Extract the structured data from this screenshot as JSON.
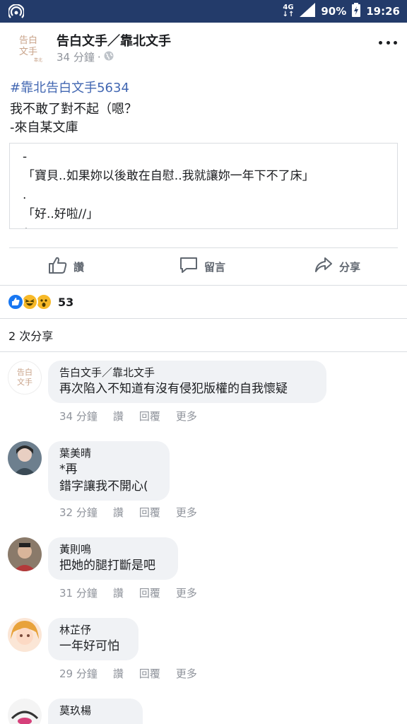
{
  "status_bar": {
    "network": "4G",
    "battery": "90%",
    "time": "19:26"
  },
  "post": {
    "page_name": "告白文手／靠北文手",
    "time": "34 分鐘",
    "meta_separator": "·",
    "avatar_text_top": "告白",
    "avatar_text_bottom": "文手",
    "avatar_text_small": "靠北",
    "hashtag": "#靠北告白文手5634",
    "text_line1": "我不敢了對不起（嗯？",
    "text_line2": "-來自某文庫",
    "quote_lines": [
      "-",
      "「寶貝..如果妳以後敢在自慰..我就讓妳一年下不了床」",
      ".",
      "「好..好啦//」",
      "/"
    ]
  },
  "actions": {
    "like": "讚",
    "comment": "留言",
    "share": "分享"
  },
  "reactions": {
    "count": "53"
  },
  "shares": {
    "text": "2 次分享"
  },
  "comment_actions": {
    "like": "讚",
    "reply": "回覆",
    "more": "更多"
  },
  "comments": [
    {
      "name": "告白文手／靠北文手",
      "lines": [
        "再次陷入不知道有沒有侵犯版權的自我懷疑"
      ],
      "time": "34 分鐘"
    },
    {
      "name": "葉美晴",
      "lines": [
        "*再",
        "錯字讓我不開心("
      ],
      "time": "32 分鐘"
    },
    {
      "name": "黃則鳴",
      "lines": [
        "把她的腿打斷是吧"
      ],
      "time": "31 分鐘"
    },
    {
      "name": "林芷伃",
      "lines": [
        "一年好可怕"
      ],
      "time": "29 分鐘"
    },
    {
      "name": "莫玖楊",
      "lines": [],
      "time": ""
    }
  ],
  "colors": {
    "status_bar": "#233b6a",
    "link": "#4267b2",
    "bubble": "#f0f2f5",
    "like_blue": "#1877f2",
    "haha_yellow": "#f7b928"
  }
}
